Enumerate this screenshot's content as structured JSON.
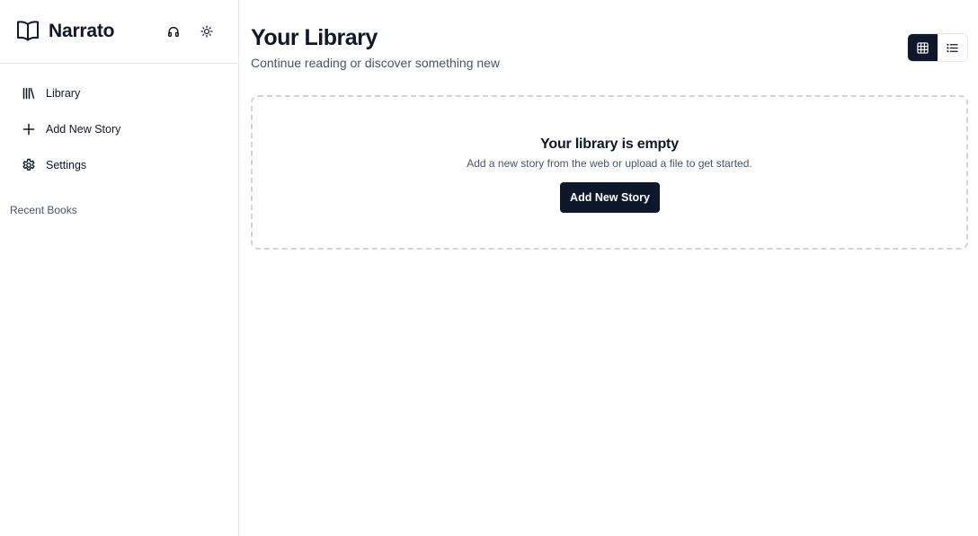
{
  "brand": {
    "name": "Narrato",
    "logo_icon": "open-book-icon"
  },
  "header_actions": [
    {
      "icon": "headphones-icon"
    },
    {
      "icon": "sun-icon"
    }
  ],
  "sidebar": {
    "items": [
      {
        "label": "Library",
        "icon": "library-icon"
      },
      {
        "label": "Add New Story",
        "icon": "plus-icon"
      },
      {
        "label": "Settings",
        "icon": "gear-icon"
      }
    ],
    "recent_heading": "Recent Books"
  },
  "main": {
    "title": "Your Library",
    "subtitle": "Continue reading or discover something new",
    "view_toggle": {
      "options": [
        {
          "icon": "grid-icon",
          "active": true
        },
        {
          "icon": "list-icon",
          "active": false
        }
      ]
    },
    "empty_state": {
      "title": "Your library is empty",
      "description": "Add a new story from the web or upload a file to get started.",
      "cta_label": "Add New Story"
    }
  },
  "colors": {
    "primary": "#0f172a",
    "muted_text": "#475569",
    "border": "#e5e7eb",
    "dashed_border": "#d4d4d8"
  }
}
